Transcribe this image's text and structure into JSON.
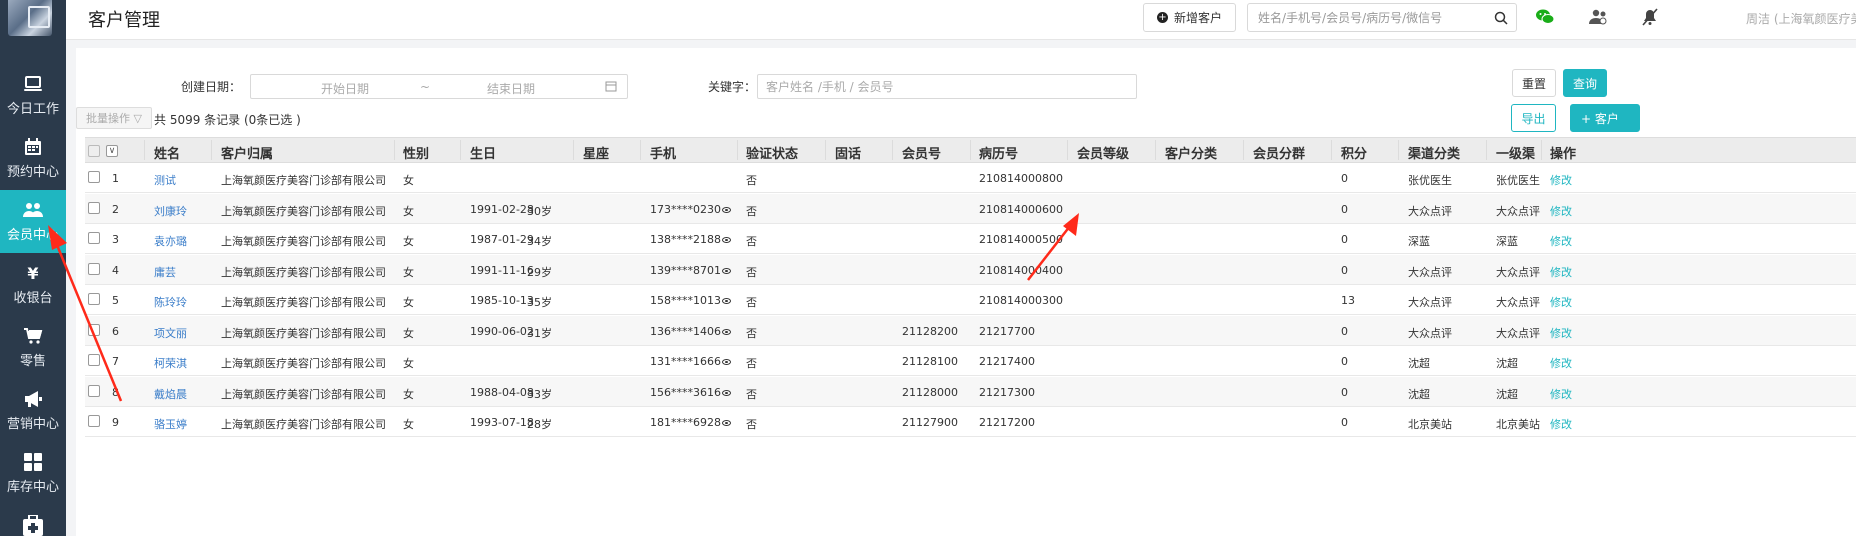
{
  "header": {
    "title": "客户管理",
    "add_customer_label": "新增客户",
    "search_placeholder": "姓名/手机号/会员号/病历号/微信号",
    "user_text": "周洁 (上海氧颜医疗美容门诊部有限"
  },
  "sidebar": {
    "items": [
      {
        "label": "今日工作",
        "icon": "monitor-icon"
      },
      {
        "label": "预约中心",
        "icon": "calendar-icon"
      },
      {
        "label": "会员中心",
        "icon": "users-icon",
        "active": true
      },
      {
        "label": "收银台",
        "icon": "yen-icon",
        "glyph": "¥"
      },
      {
        "label": "零售",
        "icon": "cart-icon"
      },
      {
        "label": "营销中心",
        "icon": "megaphone-icon"
      },
      {
        "label": "库存中心",
        "icon": "grid-icon"
      }
    ]
  },
  "filters": {
    "created_label": "创建日期：",
    "start_placeholder": "开始日期",
    "tilde": "~",
    "end_placeholder": "结束日期",
    "keyword_label": "关键字：",
    "keyword_placeholder": "客户姓名 /手机 / 会员号",
    "reset_label": "重置",
    "query_label": "查询",
    "export_label": "导出",
    "add_label": "+ 客户"
  },
  "toolbar": {
    "batch_label": "批量操作 ▽",
    "total_text": "共 5099 条记录   (0条已选 )"
  },
  "table": {
    "columns": [
      "姓名",
      "客户归属",
      "性别",
      "生日",
      "星座",
      "手机",
      "验证状态",
      "固话",
      "会员号",
      "病历号",
      "会员等级",
      "客户分类",
      "会员分群",
      "积分",
      "渠道分类",
      "一级渠",
      "操作"
    ],
    "rows": [
      {
        "no": "1",
        "name": "测试",
        "org": "上海氧颜医疗美容门诊部有限公司",
        "gender": "女",
        "birthday": "",
        "age": "",
        "phone": "",
        "verified": "否",
        "member_no": "",
        "record_no": "210814000800",
        "points": "0",
        "channel": "张优医生",
        "channel1": "张优医生",
        "op": "修改"
      },
      {
        "no": "2",
        "name": "刘康玲",
        "org": "上海氧颜医疗美容门诊部有限公司",
        "gender": "女",
        "birthday": "1991-02-28",
        "age": "30岁",
        "phone": "173****0230",
        "verified": "否",
        "member_no": "",
        "record_no": "210814000600",
        "points": "0",
        "channel": "大众点评",
        "channel1": "大众点评",
        "op": "修改"
      },
      {
        "no": "3",
        "name": "袁亦璐",
        "org": "上海氧颜医疗美容门诊部有限公司",
        "gender": "女",
        "birthday": "1987-01-29",
        "age": "34岁",
        "phone": "138****2188",
        "verified": "否",
        "member_no": "",
        "record_no": "210814000500",
        "points": "0",
        "channel": "深蓝",
        "channel1": "深蓝",
        "op": "修改"
      },
      {
        "no": "4",
        "name": "庸芸",
        "org": "上海氧颜医疗美容门诊部有限公司",
        "gender": "女",
        "birthday": "1991-11-16",
        "age": "29岁",
        "phone": "139****8701",
        "verified": "否",
        "member_no": "",
        "record_no": "210814000400",
        "points": "0",
        "channel": "大众点评",
        "channel1": "大众点评",
        "op": "修改"
      },
      {
        "no": "5",
        "name": "陈玲玲",
        "org": "上海氧颜医疗美容门诊部有限公司",
        "gender": "女",
        "birthday": "1985-10-13",
        "age": "35岁",
        "phone": "158****1013",
        "verified": "否",
        "member_no": "",
        "record_no": "210814000300",
        "points": "13",
        "channel": "大众点评",
        "channel1": "大众点评",
        "op": "修改"
      },
      {
        "no": "6",
        "name": "项文丽",
        "org": "上海氧颜医疗美容门诊部有限公司",
        "gender": "女",
        "birthday": "1990-06-02",
        "age": "31岁",
        "phone": "136****1406",
        "verified": "否",
        "member_no": "21128200",
        "record_no": "21217700",
        "points": "0",
        "channel": "大众点评",
        "channel1": "大众点评",
        "op": "修改"
      },
      {
        "no": "7",
        "name": "柯荣淇",
        "org": "上海氧颜医疗美容门诊部有限公司",
        "gender": "女",
        "birthday": "",
        "age": "",
        "phone": "131****1666",
        "verified": "否",
        "member_no": "21128100",
        "record_no": "21217400",
        "points": "0",
        "channel": "沈超",
        "channel1": "沈超",
        "op": "修改"
      },
      {
        "no": "8",
        "name": "戴焰晨",
        "org": "上海氧颜医疗美容门诊部有限公司",
        "gender": "女",
        "birthday": "1988-04-08",
        "age": "33岁",
        "phone": "156****3616",
        "verified": "否",
        "member_no": "21128000",
        "record_no": "21217300",
        "points": "0",
        "channel": "沈超",
        "channel1": "沈超",
        "op": "修改"
      },
      {
        "no": "9",
        "name": "骆玉婷",
        "org": "上海氧颜医疗美容门诊部有限公司",
        "gender": "女",
        "birthday": "1993-07-18",
        "age": "28岁",
        "phone": "181****6928",
        "verified": "否",
        "member_no": "21127900",
        "record_no": "21217200",
        "points": "0",
        "channel": "北京美站",
        "channel1": "北京美站",
        "op": "修改"
      }
    ]
  },
  "colors": {
    "accent": "#1fb6c1",
    "sidebar_bg": "#2b3a4b",
    "link": "#3a7dc9",
    "arrow": "#ff2a1a"
  }
}
